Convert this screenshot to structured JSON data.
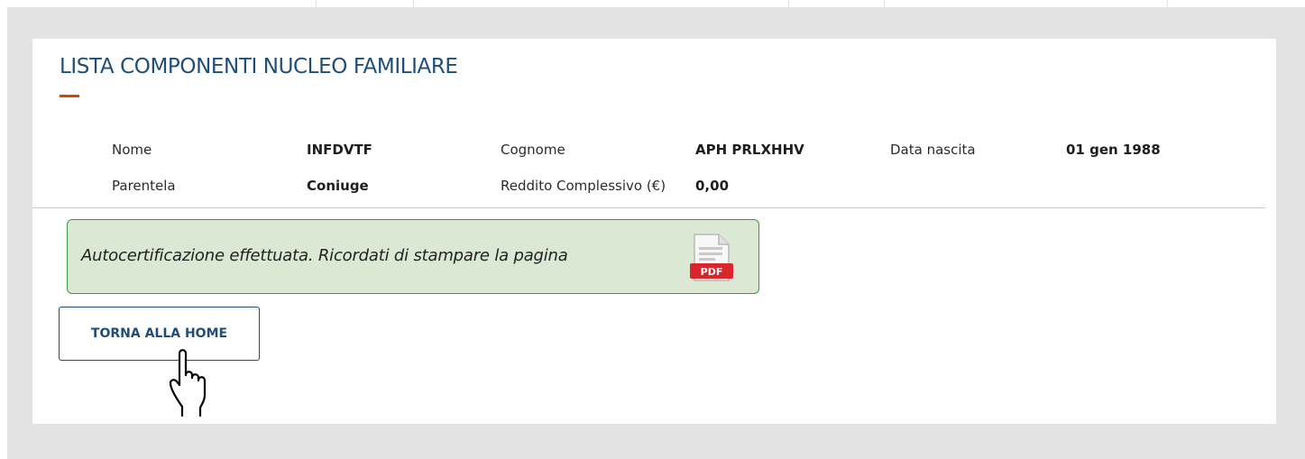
{
  "section": {
    "title": "LISTA COMPONENTI NUCLEO FAMILIARE"
  },
  "member": {
    "nome_label": "Nome",
    "nome_value": "INFDVTF",
    "cognome_label": "Cognome",
    "cognome_value": "APH PRLXHHV",
    "data_nascita_label": "Data nascita",
    "data_nascita_value": "01 gen 1988",
    "parentela_label": "Parentela",
    "parentela_value": "Coniuge",
    "reddito_label": "Reddito Complessivo (€)",
    "reddito_value": "0,00"
  },
  "notice": {
    "text": "Autocertificazione effettuata. Ricordati di stampare la pagina",
    "pdf_badge": "PDF"
  },
  "actions": {
    "home_label": "TORNA ALLA HOME"
  },
  "icons": {
    "pdf": "pdf-file-icon",
    "cursor": "hand-pointer-cursor-icon"
  },
  "colors": {
    "title": "#1f4e79",
    "accent": "#d04a02",
    "notice_background": "#dbe8d4",
    "notice_border": "#3e9a3e",
    "pdf_badge": "#d9262c",
    "button_border": "#1f4e79"
  }
}
